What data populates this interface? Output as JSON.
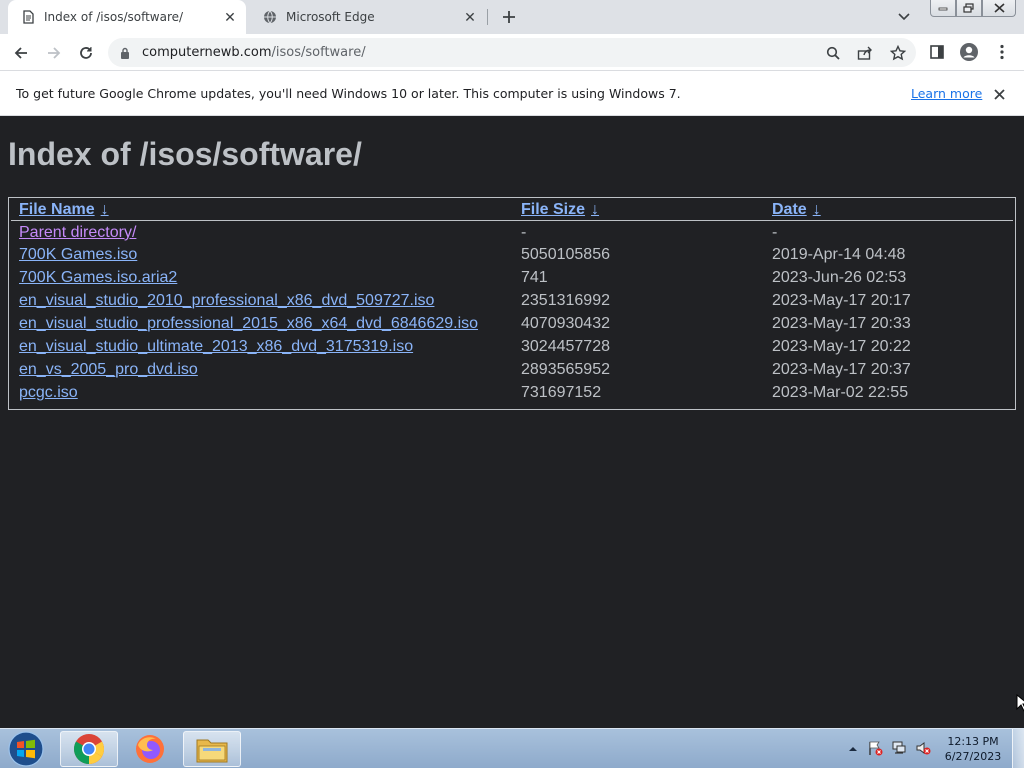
{
  "browser": {
    "tabs": [
      {
        "title": "Index of /isos/software/",
        "icon": "web-page-icon",
        "active": true
      },
      {
        "title": "Microsoft Edge",
        "icon": "globe-icon",
        "active": false
      }
    ],
    "url_host": "computernewb.com",
    "url_path": "/isos/software/"
  },
  "infobar": {
    "message": "To get future Google Chrome updates, you'll need Windows 10 or later. This computer is using Windows 7.",
    "link_label": "Learn more"
  },
  "page": {
    "title": "Index of /isos/software/",
    "columns": [
      {
        "label": "File Name",
        "sort_glyph": "↓"
      },
      {
        "label": "File Size",
        "sort_glyph": "↓"
      },
      {
        "label": "Date",
        "sort_glyph": "↓"
      }
    ],
    "rows": [
      {
        "name": "Parent directory/",
        "size": "-",
        "date": "-",
        "visited": true
      },
      {
        "name": "700K Games.iso",
        "size": "5050105856",
        "date": "2019-Apr-14 04:48",
        "visited": false
      },
      {
        "name": "700K Games.iso.aria2",
        "size": "741",
        "date": "2023-Jun-26 02:53",
        "visited": false
      },
      {
        "name": "en_visual_studio_2010_professional_x86_dvd_509727.iso",
        "size": "2351316992",
        "date": "2023-May-17 20:17",
        "visited": false
      },
      {
        "name": "en_visual_studio_professional_2015_x86_x64_dvd_6846629.iso",
        "size": "4070930432",
        "date": "2023-May-17 20:33",
        "visited": false
      },
      {
        "name": "en_visual_studio_ultimate_2013_x86_dvd_3175319.iso",
        "size": "3024457728",
        "date": "2023-May-17 20:22",
        "visited": false
      },
      {
        "name": "en_vs_2005_pro_dvd.iso",
        "size": "2893565952",
        "date": "2023-May-17 20:37",
        "visited": false
      },
      {
        "name": "pcgc.iso",
        "size": "731697152",
        "date": "2023-Mar-02 22:55",
        "visited": false
      }
    ]
  },
  "taskbar": {
    "apps": [
      "chrome-icon",
      "firefox-icon",
      "file-explorer-icon"
    ],
    "time": "12:13 PM",
    "date": "6/27/2023"
  },
  "colors": {
    "page_background": "#202124",
    "link": "#8ab4f8",
    "visited_link": "#c58af9",
    "text": "#bdc1c6"
  }
}
